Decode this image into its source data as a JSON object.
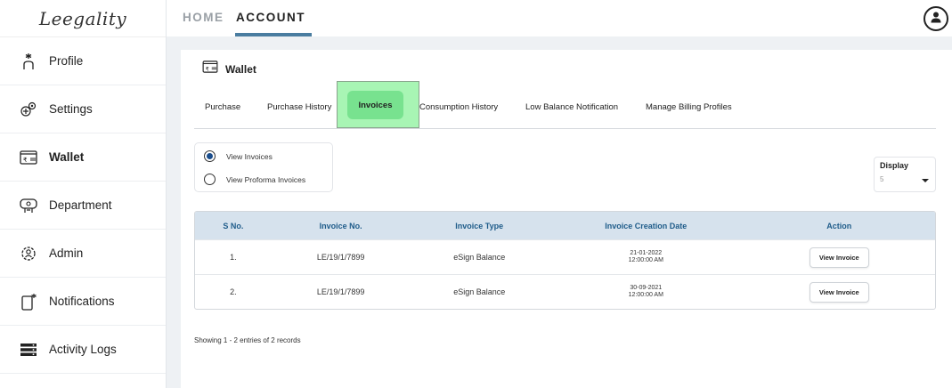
{
  "logo": {
    "text": "Leegality"
  },
  "sidebar": {
    "items": [
      {
        "label": "Profile",
        "icon": "profile-icon"
      },
      {
        "label": "Settings",
        "icon": "settings-icon"
      },
      {
        "label": "Wallet",
        "icon": "wallet-icon",
        "active": true
      },
      {
        "label": "Department",
        "icon": "department-icon"
      },
      {
        "label": "Admin",
        "icon": "admin-icon"
      },
      {
        "label": "Notifications",
        "icon": "notifications-icon"
      },
      {
        "label": "Activity Logs",
        "icon": "activity-logs-icon"
      }
    ]
  },
  "topbar": {
    "tabs": [
      {
        "label": "HOME"
      },
      {
        "label": "ACCOUNT",
        "active": true
      }
    ],
    "user_icon": "user-icon"
  },
  "wallet": {
    "title": "Wallet",
    "tabs": [
      {
        "label": "Purchase"
      },
      {
        "label": "Purchase History"
      },
      {
        "label": "Invoices",
        "active": true
      },
      {
        "label": "Consumption History"
      },
      {
        "label": "Low Balance Notification"
      },
      {
        "label": "Manage Billing Profiles"
      }
    ],
    "radio_options": [
      {
        "label": "View Invoices",
        "selected": true
      },
      {
        "label": "View Proforma Invoices",
        "selected": false
      }
    ],
    "display": {
      "label": "Display",
      "value": "5"
    },
    "table": {
      "headers": [
        "S No.",
        "Invoice No.",
        "Invoice Type",
        "Invoice Creation Date",
        "Action"
      ],
      "rows": [
        {
          "sno": "1.",
          "invoice_no": "LE/19/1/7899",
          "type": "eSign Balance",
          "date": "21-01-2022",
          "time": "12:00:00 AM",
          "action": "View Invoice"
        },
        {
          "sno": "2.",
          "invoice_no": "LE/19/1/7899",
          "type": "eSign Balance",
          "date": "30-09-2021",
          "time": "12:00:00 AM",
          "action": "View Invoice"
        }
      ]
    },
    "showing_text": "Showing 1 - 2 entries of 2 records"
  },
  "colors": {
    "accent": "#4a7da0",
    "table_header_bg": "#d6e2ed",
    "table_header_text": "#1f5c8a",
    "highlight_bg": "#a8f5b4",
    "active_pill": "#78e28f"
  }
}
